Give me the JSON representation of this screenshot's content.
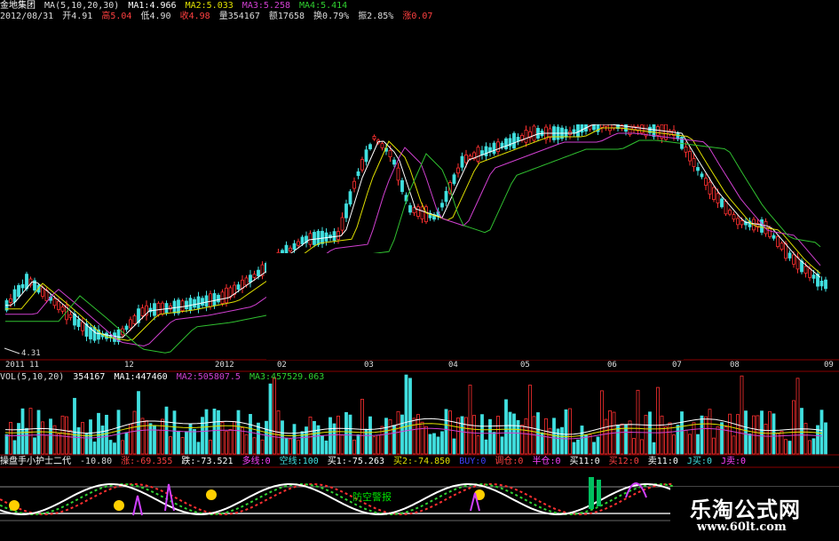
{
  "header": {
    "stock": "金地集团",
    "ma_params": "MA(5,10,20,30)",
    "ma1": "MA1:4.966",
    "ma2": "MA2:5.033",
    "ma3": "MA3:5.258",
    "ma4": "MA4:5.414",
    "date": "2012/08/31",
    "open": "开4.91",
    "high": "高5.04",
    "low": "低4.90",
    "close": "收4.98",
    "volume": "量354167",
    "amount": "额17658",
    "turnover": "换0.79%",
    "amplitude": "振2.85%",
    "change": "涨0.07"
  },
  "price_chart": {
    "low_marker": "4.31",
    "months": [
      "2011 11",
      "12",
      "2012",
      "02",
      "03",
      "04",
      "05",
      "06",
      "07",
      "08",
      "09"
    ]
  },
  "volume": {
    "params": "VOL(5,10,20)",
    "vol": "354167",
    "ma1": "MA1:447460",
    "ma2": "MA2:505807.5",
    "ma3": "MA3:457529.063"
  },
  "indicator": {
    "name": "操盘手小护士二代",
    "v1": "-10.80",
    "v2": "涨:-69.355",
    "v3": "跌:-73.521",
    "v4": "多线:0",
    "v5": "空线:100",
    "v6": "买1:-75.263",
    "v7": "买2:-74.850",
    "v8": "BUY:0",
    "v9": "调仓:0",
    "v10": "半仓:0",
    "v11": "买11:0",
    "v12": "买12:0",
    "v13": "卖11:0",
    "v14": "J买:0",
    "v15": "J卖:0",
    "warning": "防空警报"
  },
  "brand": {
    "name": "乐淘公式网",
    "url": "www.60lt.com"
  },
  "colors": {
    "up": "#ff3030",
    "down": "#40e0e0",
    "ma5": "#ffffff",
    "ma10": "#e0e000",
    "ma20": "#d040d0",
    "ma30": "#30c030",
    "bg": "#000000"
  }
}
